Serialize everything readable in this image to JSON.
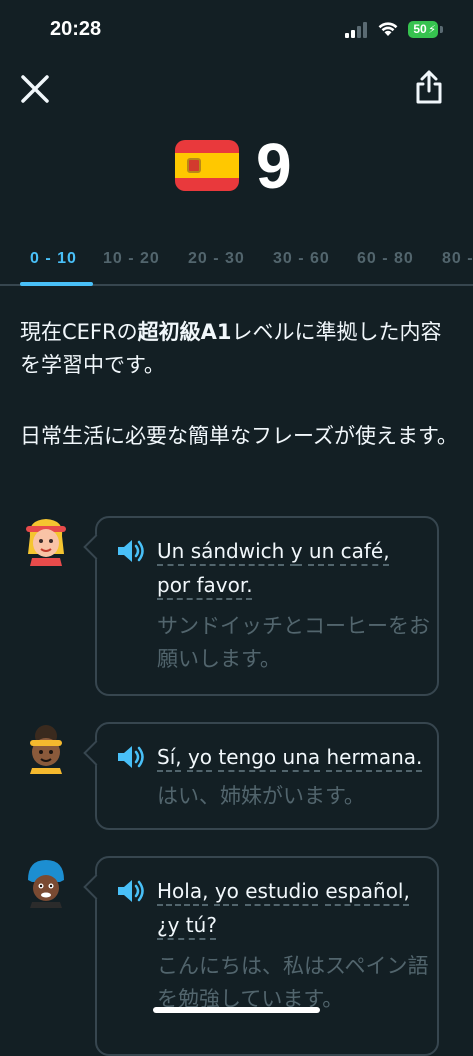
{
  "status_bar": {
    "time": "20:28",
    "battery": "50"
  },
  "header": {
    "score": "9",
    "flag_icon": "spain-flag-icon"
  },
  "tabs": [
    {
      "label": "0 - 10",
      "active": true
    },
    {
      "label": "10 - 20"
    },
    {
      "label": "20 - 30"
    },
    {
      "label": "30 - 60"
    },
    {
      "label": "60 - 80"
    },
    {
      "label": "80 -"
    }
  ],
  "description": {
    "line1_pre": "現在CEFRの",
    "line1_bold": "超初級A1",
    "line1_post": "レベルに準拠した内容を学習中です。",
    "line2": "日常生活に必要な簡単なフレーズが使えます。"
  },
  "sentences": [
    {
      "words": [
        "Un",
        "sándwich",
        "y",
        "un",
        "café,",
        "por favor."
      ],
      "text": "Un sándwich y un café, por favor.",
      "translation": "サンドイッチとコーヒーをお願いします。"
    },
    {
      "words": [
        "Sí,",
        "yo",
        "tengo",
        "una",
        "hermana."
      ],
      "text": "Sí, yo tengo una hermana.",
      "translation": "はい、姉妹がいます。"
    },
    {
      "words": [
        "Hola,",
        "yo",
        "estudio",
        "español,",
        "¿y tú?"
      ],
      "text": "Hola, yo estudio español, ¿y tú?",
      "translation": "こんにちは、私はスペイン語を勉強しています。"
    }
  ],
  "colors": {
    "background": "#131f24",
    "accent": "#49c0f8",
    "muted": "#52656d",
    "border": "#37464f"
  }
}
